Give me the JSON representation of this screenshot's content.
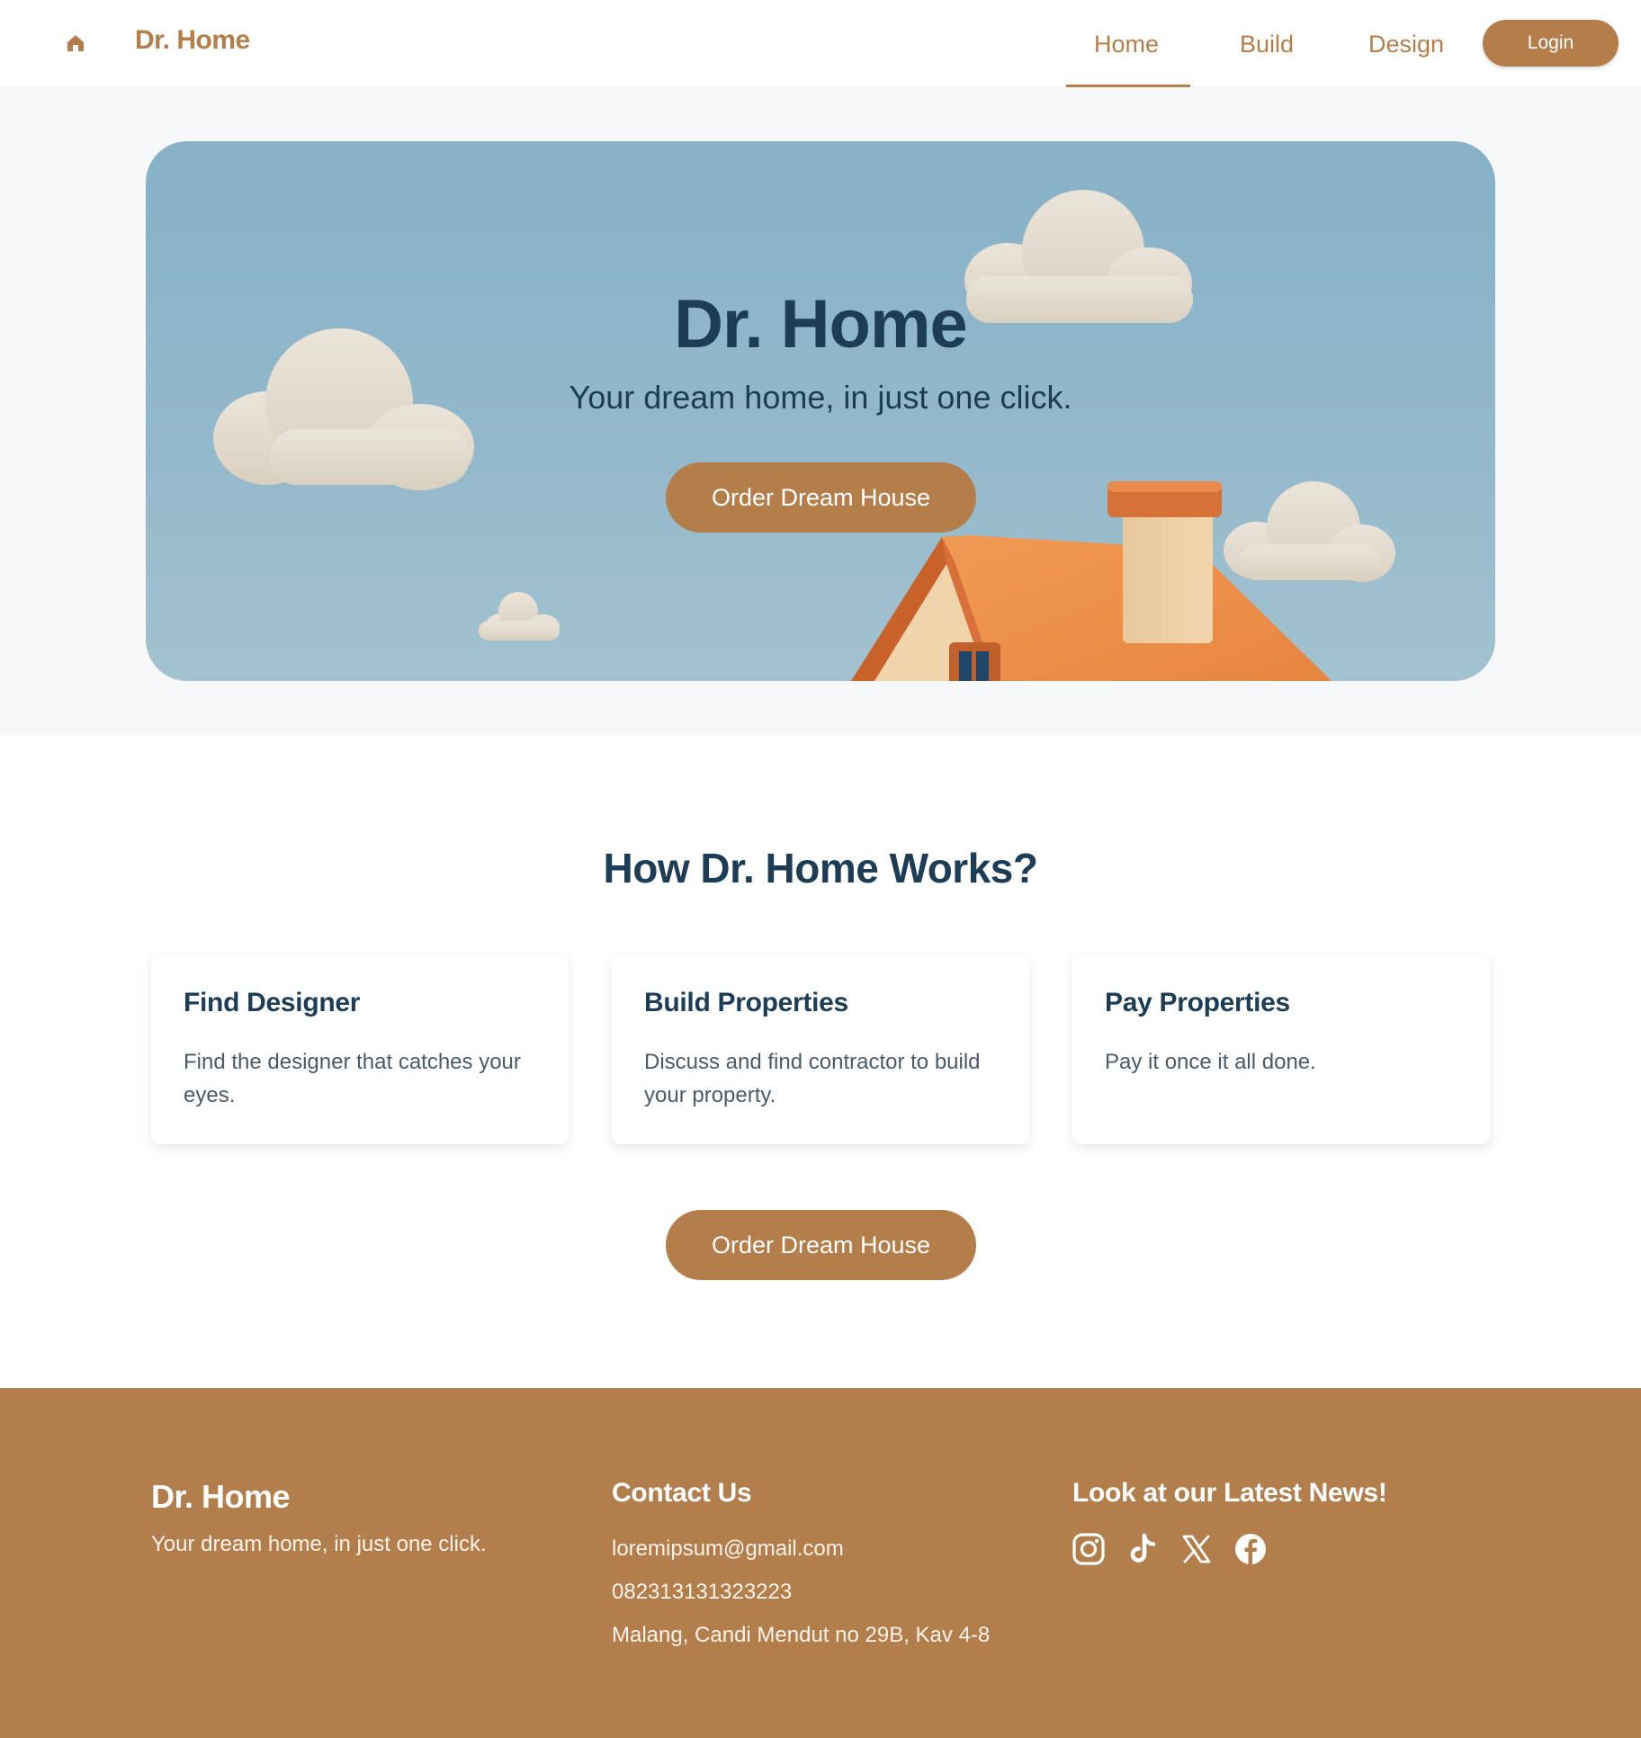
{
  "nav": {
    "brand": "Dr. Home",
    "links": [
      {
        "label": "Home",
        "active": true
      },
      {
        "label": "Build"
      },
      {
        "label": "Design"
      }
    ],
    "login_label": "Login",
    "home_icon": "home-icon"
  },
  "hero": {
    "title": "Dr. Home",
    "subtitle": "Your dream home, in just one click.",
    "button_label": "Order Dream House"
  },
  "how": {
    "title": "How Dr. Home Works?",
    "cards": [
      {
        "title": "Find Designer",
        "text": "Find the designer that catches your eyes."
      },
      {
        "title": "Build Properties",
        "text": "Discuss and find contractor to build your property."
      },
      {
        "title": "Pay Properties",
        "text": "Pay it once it all done."
      }
    ],
    "button_label": "Order Dream House"
  },
  "footer": {
    "brand": "Dr. Home",
    "tagline": "Your dream home, in just one click.",
    "contact": {
      "heading": "Contact Us",
      "email": "loremipsum@gmail.com",
      "phone": "082313131323223",
      "address": "Malang, Candi Mendut no 29B, Kav 4-8"
    },
    "news": {
      "heading": "Look at our Latest News!",
      "icons": [
        "instagram-icon",
        "tiktok-icon",
        "x-icon",
        "facebook-icon"
      ]
    }
  },
  "colors": {
    "brand": "#b47e4b",
    "navy": "#1d3c55",
    "sky": "#8ab3c8",
    "roof": "#e98a48",
    "footer": "#b27f4c"
  }
}
